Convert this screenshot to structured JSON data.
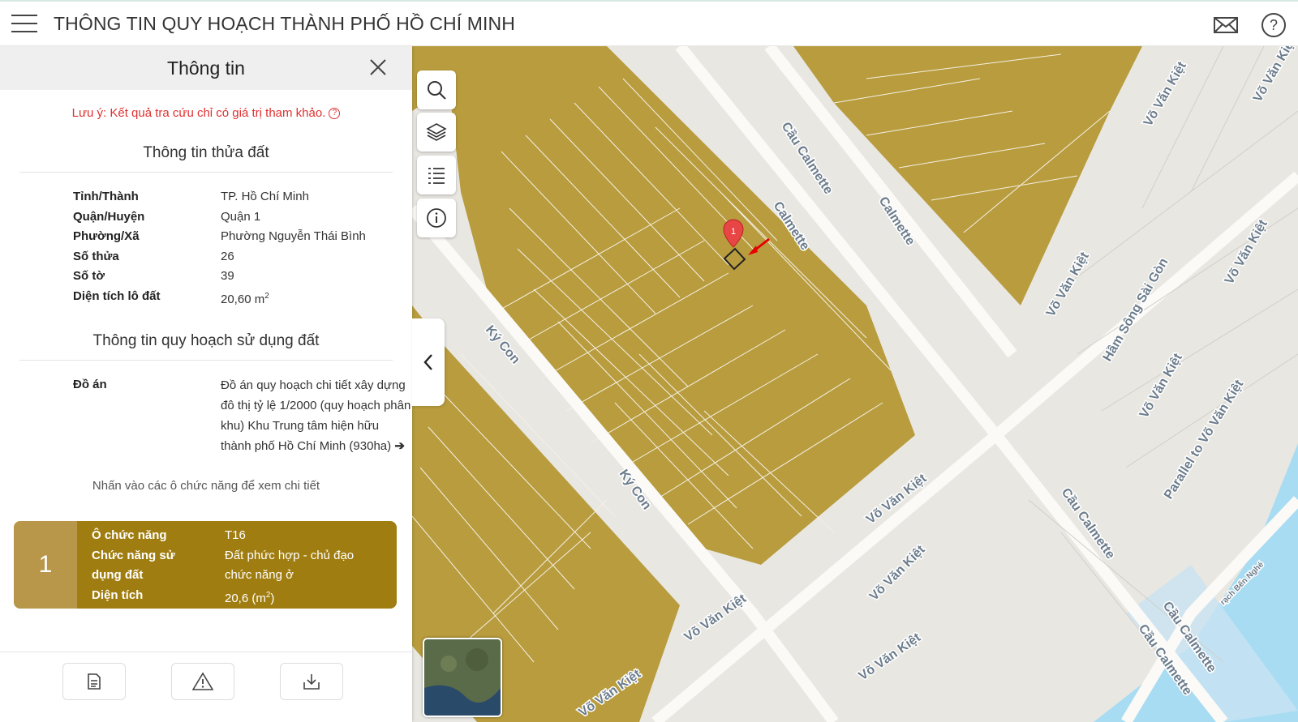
{
  "header": {
    "title": "THÔNG TIN QUY HOẠCH THÀNH PHỐ HỒ CHÍ MINH"
  },
  "panel": {
    "title": "Thông tin",
    "note": "Lưu ý: Kết quả tra cứu chỉ có giá trị tham khảo.",
    "land_section_title": "Thông tin thửa đất",
    "land_info": [
      {
        "label": "Tỉnh/Thành",
        "value": "TP. Hồ Chí Minh"
      },
      {
        "label": "Quận/Huyện",
        "value": "Quận 1"
      },
      {
        "label": "Phường/Xã",
        "value": "Phường Nguyễn Thái Bình"
      },
      {
        "label": "Số thửa",
        "value": "26"
      },
      {
        "label": "Số tờ",
        "value": "39"
      },
      {
        "label": "Diện tích lô đất",
        "value": "20,60 m",
        "unit_sup": "2"
      }
    ],
    "planning_section_title": "Thông tin quy hoạch sử dụng đất",
    "plan_label": "Đồ án",
    "plan_value": "Đồ án quy hoạch chi tiết xây dựng đô thị tỷ lệ 1/2000 (quy hoạch phân khu) Khu Trung tâm hiện hữu thành phố Hồ Chí Minh (930ha)",
    "hint": "Nhấn vào các ô chức năng để xem chi tiết",
    "function_card": {
      "number": "1",
      "rows": [
        {
          "label": "Ô chức năng",
          "value": "T16"
        },
        {
          "label": "Chức năng sử dụng đất",
          "value": "Đất phức hợp - chủ đạo chức năng ở"
        },
        {
          "label": "Diện tích",
          "value": "20,6 (m",
          "sup": "2",
          "suffix": ")"
        }
      ],
      "color": "#a07d10",
      "number_bg": "#b8974a"
    },
    "bottom_buttons": [
      "document-icon",
      "warning-icon",
      "download-icon"
    ]
  },
  "map": {
    "marker_label": "1",
    "land_color": "#b89c3e",
    "water_color": "#a8dcf2",
    "road_labels": [
      "Cầu Calmette",
      "Calmette",
      "Calmette",
      "Calmette",
      "Ký Con",
      "Ký Con",
      "Võ Văn Kiệt",
      "Võ Văn Kiệt",
      "Võ Văn Kiệt",
      "Võ Văn Kiệt",
      "Võ Văn Kiệt",
      "Võ Văn Kiệt",
      "Võ Văn Kiệt",
      "Võ Văn Kiệt",
      "Võ Văn Kiệt",
      "Võ Văn Kiệt",
      "Hầm Sông Sài Gòn",
      "Parallel to Võ Văn Kiệt",
      "Cầu Calmette",
      "Cầu Calmette",
      "Cầu Calmette",
      "rạch Bến Nghé"
    ],
    "tools": [
      "search-icon",
      "layers-icon",
      "list-icon",
      "info-icon"
    ]
  }
}
